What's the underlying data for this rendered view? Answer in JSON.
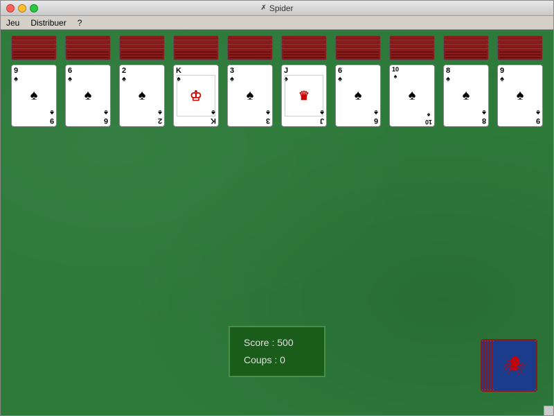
{
  "window": {
    "title": "Spider",
    "title_icon": "✗"
  },
  "menu": {
    "items": [
      "Jeu",
      "Distribuer",
      "?"
    ]
  },
  "score": {
    "label_score": "Score :",
    "value_score": "500",
    "label_coups": "Coups :",
    "value_coups": "0"
  },
  "columns": [
    {
      "id": 0,
      "backs": 4,
      "visible_rank": "9",
      "visible_suit": "♠",
      "back_rank": "6"
    },
    {
      "id": 1,
      "backs": 4,
      "visible_rank": "6",
      "visible_suit": "♠",
      "back_rank": "9"
    },
    {
      "id": 2,
      "backs": 4,
      "visible_rank": "2",
      "visible_suit": "♠",
      "back_rank": "2"
    },
    {
      "id": 3,
      "backs": 4,
      "visible_rank": "K",
      "visible_suit": "♠",
      "face": true,
      "back_rank": "K"
    },
    {
      "id": 4,
      "backs": 4,
      "visible_rank": "3",
      "visible_suit": "♠",
      "back_rank": "3"
    },
    {
      "id": 5,
      "backs": 4,
      "visible_rank": "J",
      "visible_suit": "♠",
      "face": true,
      "back_rank": "J"
    },
    {
      "id": 6,
      "backs": 4,
      "visible_rank": "6",
      "visible_suit": "♠",
      "back_rank": "9"
    },
    {
      "id": 7,
      "backs": 4,
      "visible_rank": "10",
      "visible_suit": "♠",
      "back_rank": "01"
    },
    {
      "id": 8,
      "backs": 4,
      "visible_rank": "8",
      "visible_suit": "♠",
      "back_rank": "8"
    },
    {
      "id": 9,
      "backs": 4,
      "visible_rank": "9",
      "visible_suit": "♠",
      "back_rank": "6"
    }
  ],
  "colors": {
    "green_table": "#2d7a3a",
    "card_back_red": "#8b1a1a",
    "score_bg": "#1a5c1a"
  }
}
